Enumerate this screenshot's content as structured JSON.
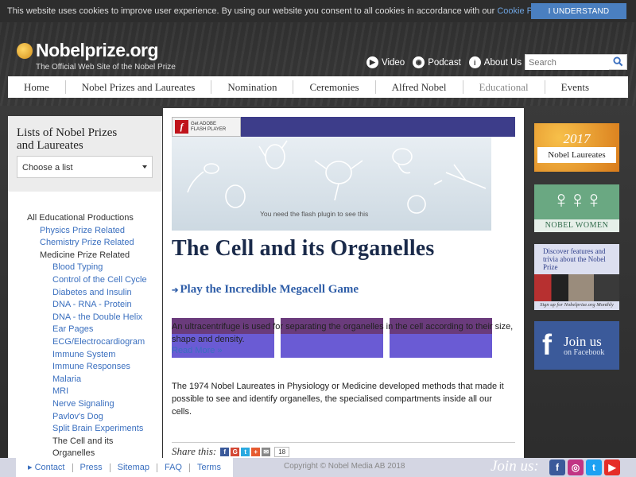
{
  "cookie": {
    "text": "This website uses cookies to improve user experience. By using our website you consent to all cookies in accordance with our ",
    "policy_link": "Cookie Policy",
    "suffix": ".",
    "button": "I UNDERSTAND"
  },
  "header": {
    "logo": "Nobelprize.org",
    "tagline": "The Official Web Site of the Nobel Prize",
    "links": {
      "video": "Video",
      "podcast": "Podcast",
      "about": "About Us"
    },
    "search_placeholder": "Search"
  },
  "nav": {
    "home": "Home",
    "prizes": "Nobel Prizes and Laureates",
    "nomination": "Nomination",
    "ceremonies": "Ceremonies",
    "alfred": "Alfred Nobel",
    "educational": "Educational",
    "events": "Events"
  },
  "sidebar": {
    "heading_line1": "Lists of Nobel Prizes",
    "heading_line2": "and Laureates",
    "select_value": "Choose a list",
    "tree": {
      "root": "All Educational Productions",
      "physics": "Physics Prize Related",
      "chemistry": "Chemistry Prize Related",
      "medicine": "Medicine Prize Related",
      "items": [
        "Blood Typing",
        "Control of the Cell Cycle",
        "Diabetes and Insulin",
        "DNA - RNA - Protein",
        "DNA - the Double Helix",
        "Ear Pages",
        "ECG/Electrocardiogram",
        "Immune System",
        "Immune Responses",
        "Malaria",
        "MRI",
        "Nerve Signaling",
        "Pavlov's Dog",
        "Split Brain Experiments"
      ],
      "current_line1": "The Cell and its",
      "current_line2": "Organelles"
    }
  },
  "content": {
    "flash_button_line1": "Get ADOBE",
    "flash_button_line2": "FLASH PLAYER",
    "flash_logo": "f",
    "flash_message": "You need the flash plugin to see this",
    "title": "The Cell and its Organelles",
    "game_link": "Play the Incredible Megacell Game",
    "overlay_text": "An ultracentrifuge is used for separating the organelles in the cell according to their size, shape and density.",
    "read_more": "Read More »",
    "paragraph": "The 1974 Nobel Laureates in Physiology or Medicine developed methods that made it possible to see and identify organelles, the specialised compartments inside all our cells.",
    "share_label": "Share this:",
    "share_count": "18"
  },
  "right": {
    "laureates_year": "2017",
    "laureates_label": "Nobel Laureates",
    "women_label": "NOBEL WOMEN",
    "trivia_text": "Discover features and trivia about the Nobel Prize",
    "trivia_signup": "Sign up for Nobelprize.org Monthly",
    "fb_join": "Join us",
    "fb_on": "on Facebook"
  },
  "footer": {
    "contact": "Contact",
    "press": "Press",
    "sitemap": "Sitemap",
    "faq": "FAQ",
    "terms": "Terms",
    "copyright": "Copyright © Nobel Media AB 2018",
    "join": "Join us:"
  },
  "colors": {
    "link": "#3a6fbf",
    "facebook": "#3b5a9a",
    "flash_banner": "#3d3d8a",
    "tile": "#6a3b7c"
  }
}
